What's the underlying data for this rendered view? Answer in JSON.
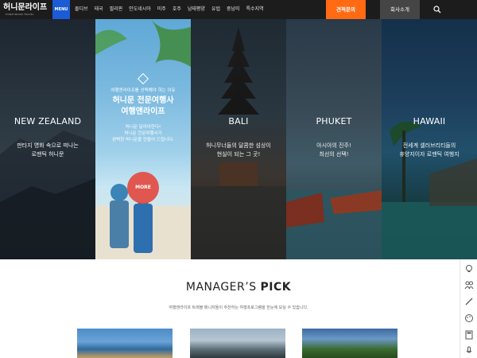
{
  "header": {
    "logo_text": "허니문",
    "logo_text2": "라이프",
    "logo_tagline": "HONEYMOON TRAVEL",
    "menu_label": "MENU",
    "nav_items": [
      "몰디브",
      "태국",
      "필리핀",
      "인도네시아",
      "미주",
      "호주",
      "남태평양",
      "유럽",
      "중남미",
      "특수지역"
    ],
    "quote_label": "견적문의",
    "about_label": "회사소개",
    "colors": {
      "menu": "#1b5bd6",
      "quote": "#ff6a13",
      "about": "#454545"
    }
  },
  "hero": {
    "panels": [
      {
        "name": "NEW ZEALAND",
        "desc1": "판타지 영화 속으로 떠나는",
        "desc2": "로맨틱 허니문"
      },
      {
        "eyebrow": "여행앤라이프를 선택해야 하는 이유",
        "title1": "허니문 전문여행사",
        "title2": "여행앤라이프",
        "sub1": "허니문 달라야한다!",
        "sub2": "허니문 전문여행사가",
        "sub3": "완벽한 허니문을 만들어 드립니다.",
        "more": "MORE"
      },
      {
        "name": "BALI",
        "desc1": "허니무너들의 달콤한 섬상이",
        "desc2": "현실이 되는 그 곳!"
      },
      {
        "name": "PHUKET",
        "desc1": "아시아의 진주!",
        "desc2": "최선의 선택!"
      },
      {
        "name": "HAWAII",
        "desc1": "전세계 셀러브리티들의",
        "desc2": "휴양지이자 로맨틱 여행지"
      }
    ]
  },
  "pick": {
    "title_a": "MANAGER’S ",
    "title_b": "PICK",
    "subtitle": "여행앤라이프 트래블 매니저들이 추천하는 여행프로그램을 한눈에 보실 수 있습니다."
  },
  "side_icons": [
    "lightbulb-icon",
    "people-icon",
    "pen-icon",
    "palette-icon",
    "calculator-icon",
    "microphone-icon"
  ]
}
